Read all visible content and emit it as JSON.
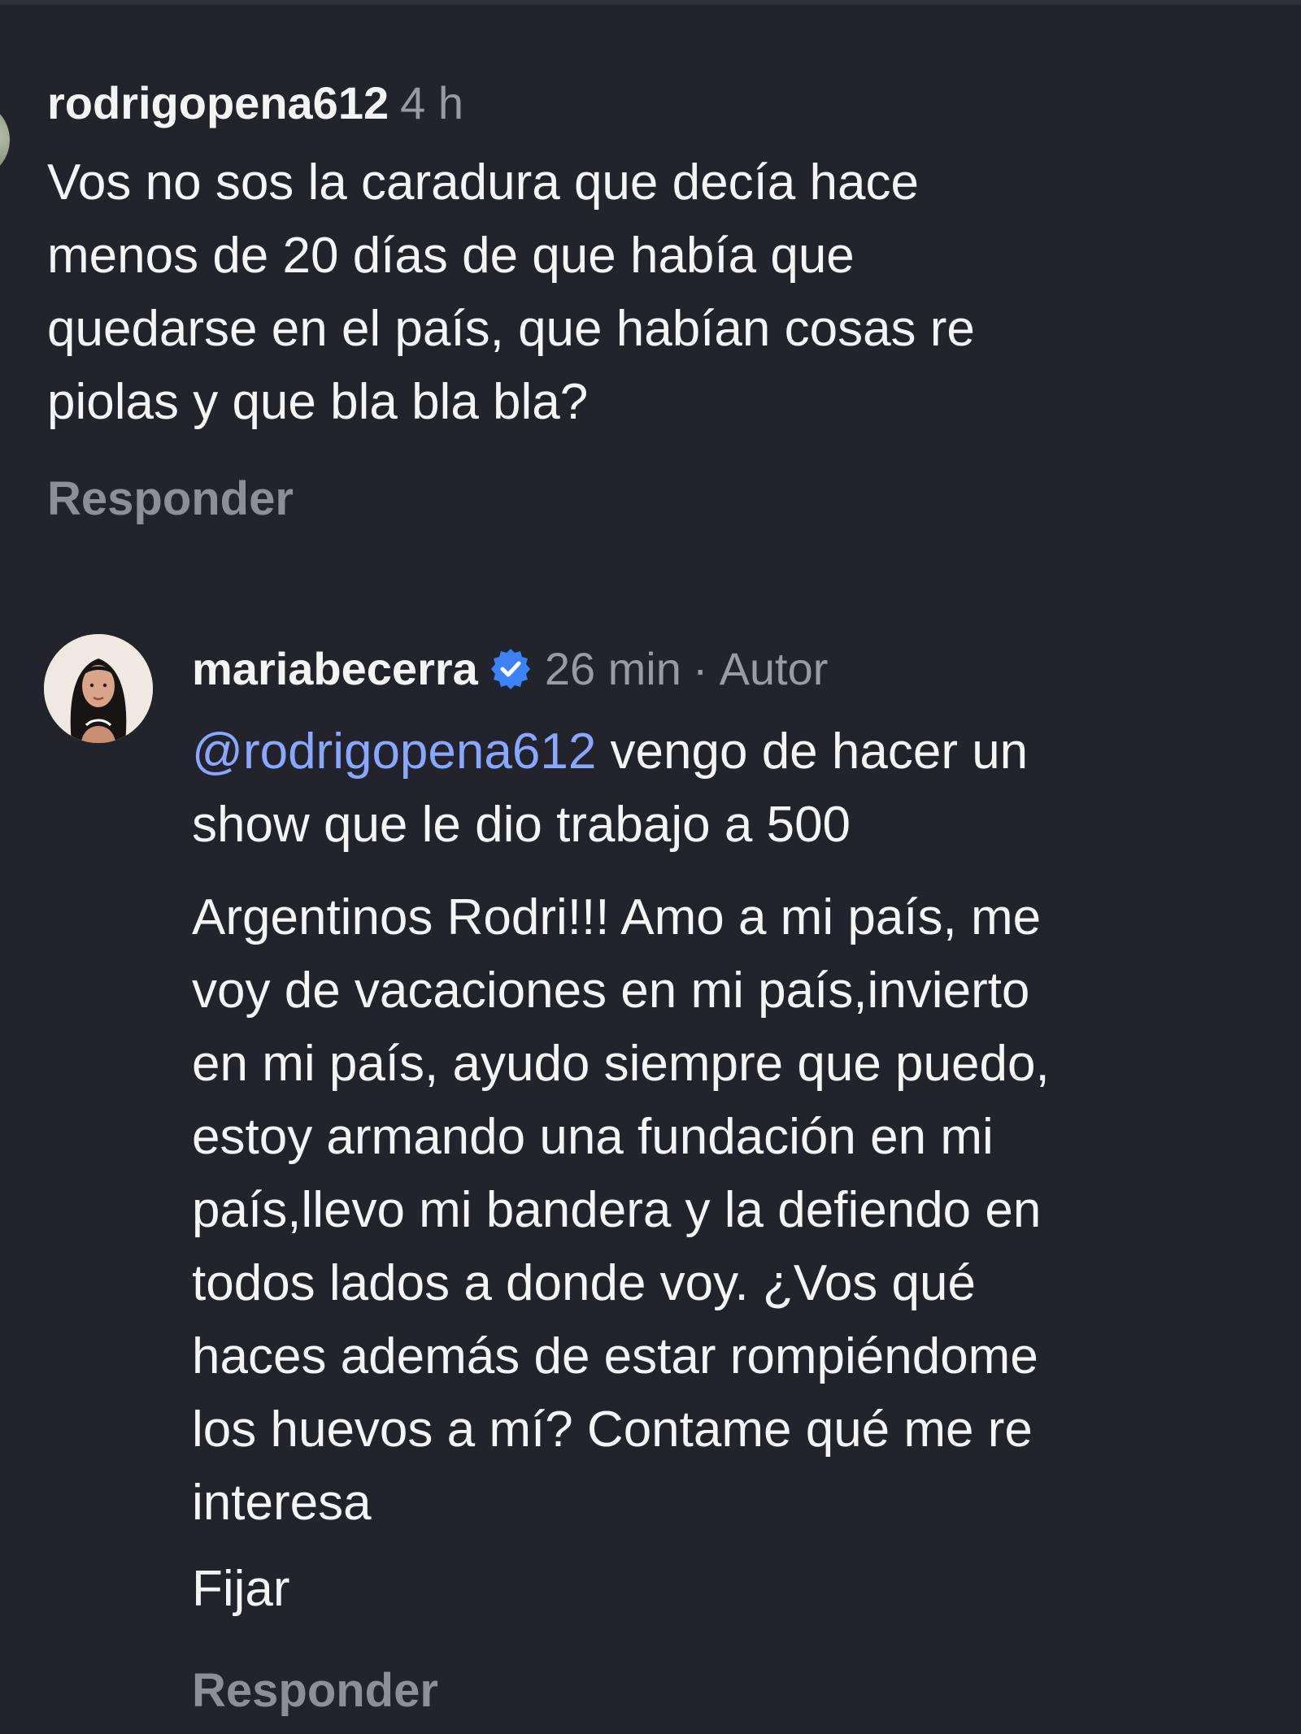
{
  "comment_1": {
    "username": "rodrigopena612",
    "time": "4 h",
    "text": "Vos no sos la caradura que decía hace\nmenos de 20 días de que había que\nquedarse en el país, que habían cosas re\npiolas y que bla bla bla?",
    "reply_label": "Responder"
  },
  "comment_2": {
    "username": "mariabecerra",
    "verified_icon": "verified-badge-icon",
    "time": "26 min",
    "separator": "·",
    "author_label": "Autor",
    "mention": "@rodrigopena612",
    "text_line_1_rest": " vengo de hacer un\nshow que le dio trabajo a 500",
    "text_para_2": "Argentinos Rodri!!! Amo a mi país, me\nvoy de vacaciones en mi país,invierto\nen mi país, ayudo siempre que puedo,\nestoy armando una fundación en mi\npaís,llevo mi bandera y la defiendo en\ntodos lados a donde voy. ¿Vos qué\nhaces además de estar rompiéndome\nlos huevos a mí? Contame qué me re\ninteresa",
    "pin_label": "Fijar",
    "reply_label": "Responder"
  },
  "colors": {
    "background": "#23232b",
    "text": "#f5f5f7",
    "muted": "#9a9aa4",
    "mention": "#8aa7ff",
    "verified": "#3b82f6"
  }
}
